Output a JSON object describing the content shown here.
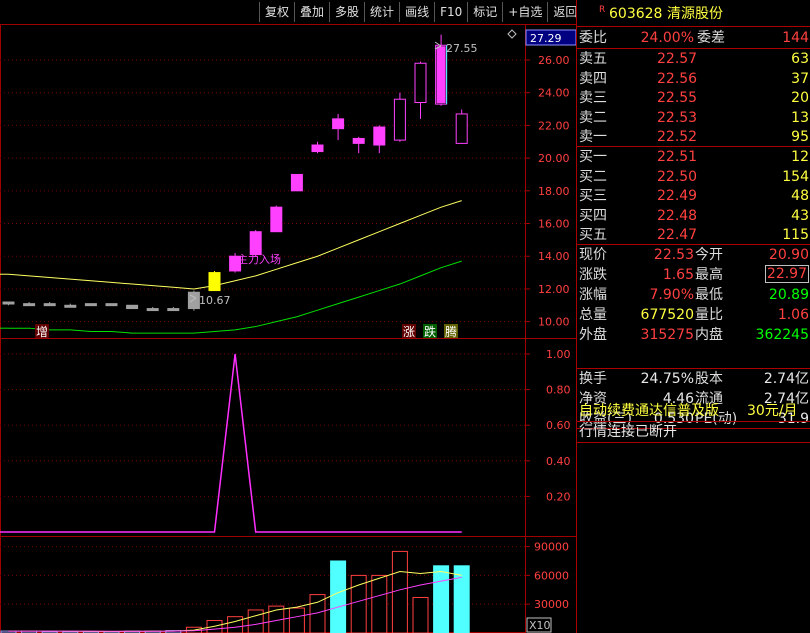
{
  "toolbar": {
    "buttons": [
      "复权",
      "叠加",
      "多股",
      "统计",
      "画线",
      "F10",
      "标记",
      "+自选",
      "返回"
    ]
  },
  "stock": {
    "flag": "R",
    "code": "603628",
    "name": "清源股份"
  },
  "ratio": {
    "label1": "委比",
    "val1": "24.00%",
    "label2": "委差",
    "val2": "144"
  },
  "sell": [
    {
      "label": "卖五",
      "price": "22.57",
      "vol": "63"
    },
    {
      "label": "卖四",
      "price": "22.56",
      "vol": "37"
    },
    {
      "label": "卖三",
      "price": "22.55",
      "vol": "20"
    },
    {
      "label": "卖二",
      "price": "22.53",
      "vol": "13"
    },
    {
      "label": "卖一",
      "price": "22.52",
      "vol": "95"
    }
  ],
  "buy": [
    {
      "label": "买一",
      "price": "22.51",
      "vol": "12"
    },
    {
      "label": "买二",
      "price": "22.50",
      "vol": "154"
    },
    {
      "label": "买三",
      "price": "22.49",
      "vol": "48"
    },
    {
      "label": "买四",
      "price": "22.48",
      "vol": "43"
    },
    {
      "label": "买五",
      "price": "22.47",
      "vol": "115"
    }
  ],
  "quote": [
    {
      "l1": "现价",
      "v1": "22.53",
      "l2": "今开",
      "v2": "20.90"
    },
    {
      "l1": "涨跌",
      "v1": "1.65",
      "l2": "最高",
      "v2": "22.97"
    },
    {
      "l1": "涨幅",
      "v1": "7.90%",
      "l2": "最低",
      "v2": "20.89"
    },
    {
      "l1": "总量",
      "v1": "677520",
      "l2": "量比",
      "v2": "1.06"
    },
    {
      "l1": "外盘",
      "v1": "315275",
      "l2": "内盘",
      "v2": "362245"
    }
  ],
  "fundamentals": [
    {
      "l1": "换手",
      "v1": "24.75%",
      "l2": "股本",
      "v2": "2.74亿"
    },
    {
      "l1": "净资",
      "v1": "4.46",
      "l2": "流通",
      "v2": "2.74亿"
    },
    {
      "l1": "收益(三)",
      "v1": "0.530",
      "l2": "PE(动)",
      "v2": "31.9"
    }
  ],
  "ad": {
    "text": "自动续费通达信普及版",
    "price": "30元/月"
  },
  "status": "行情连接已断开",
  "chart_data": {
    "type": "candlestick",
    "price_axis": {
      "ticks": [
        "26.00",
        "24.00",
        "22.00",
        "20.00",
        "18.00",
        "16.00",
        "14.00",
        "12.00",
        "10.00"
      ],
      "current": "27.29",
      "ylim": [
        9.0,
        28.2
      ]
    },
    "annotations": {
      "high": "27.55",
      "low": "10.67",
      "signal": "主力入场",
      "markers": [
        "增",
        "涨",
        "跌",
        "腾"
      ]
    },
    "candles": [
      {
        "o": 11.2,
        "c": 11.1,
        "h": 11.2,
        "l": 11.0
      },
      {
        "o": 11.1,
        "c": 11.1,
        "h": 11.2,
        "l": 11.0
      },
      {
        "o": 11.1,
        "c": 11.0,
        "h": 11.2,
        "l": 11.0
      },
      {
        "o": 11.0,
        "c": 11.0,
        "h": 11.1,
        "l": 11.0
      },
      {
        "o": 11.0,
        "c": 11.1,
        "h": 11.1,
        "l": 11.0
      },
      {
        "o": 11.0,
        "c": 11.1,
        "h": 11.1,
        "l": 11.0
      },
      {
        "o": 11.0,
        "c": 10.8,
        "h": 11.0,
        "l": 10.8
      },
      {
        "o": 10.8,
        "c": 10.8,
        "h": 10.9,
        "l": 10.7
      },
      {
        "o": 10.8,
        "c": 10.8,
        "h": 10.9,
        "l": 10.7
      },
      {
        "o": 11.8,
        "c": 10.8,
        "h": 11.9,
        "l": 10.67
      },
      {
        "o": 11.9,
        "c": 13.0,
        "h": 13.1,
        "l": 11.9
      },
      {
        "o": 13.1,
        "c": 14.0,
        "h": 14.2,
        "l": 13.0
      },
      {
        "o": 14.1,
        "c": 15.5,
        "h": 15.6,
        "l": 14.0
      },
      {
        "o": 15.5,
        "c": 17.0,
        "h": 17.1,
        "l": 15.5
      },
      {
        "o": 18.0,
        "c": 19.0,
        "h": 19.0,
        "l": 18.0
      },
      {
        "o": 20.4,
        "c": 20.8,
        "h": 21.0,
        "l": 20.3
      },
      {
        "o": 21.8,
        "c": 22.4,
        "h": 22.7,
        "l": 21.1
      },
      {
        "o": 21.2,
        "c": 20.9,
        "h": 21.3,
        "l": 20.3
      },
      {
        "o": 20.8,
        "c": 21.9,
        "h": 22.0,
        "l": 20.3
      },
      {
        "o": 21.1,
        "c": 23.6,
        "h": 24.0,
        "l": 21.0
      },
      {
        "o": 23.4,
        "c": 25.8,
        "h": 25.9,
        "l": 22.4
      },
      {
        "o": 23.3,
        "c": 26.9,
        "h": 27.55,
        "l": 23.2
      },
      {
        "o": 22.7,
        "c": 20.9,
        "h": 22.97,
        "l": 20.89
      }
    ],
    "ma_yellow": [
      12.9,
      12.8,
      12.7,
      12.6,
      12.5,
      12.4,
      12.3,
      12.2,
      12.1,
      12.0,
      12.2,
      12.5,
      12.8,
      13.2,
      13.6,
      14.0,
      14.5,
      15.0,
      15.5,
      16.0,
      16.5,
      17.0,
      17.4
    ],
    "ma_green": [
      9.6,
      9.6,
      9.5,
      9.5,
      9.4,
      9.4,
      9.3,
      9.3,
      9.3,
      9.3,
      9.4,
      9.5,
      9.7,
      10.0,
      10.3,
      10.7,
      11.1,
      11.5,
      11.9,
      12.3,
      12.8,
      13.3,
      13.7
    ],
    "indicator": {
      "ticks": [
        "1.00",
        "0.80",
        "0.60",
        "0.40",
        "0.20"
      ],
      "values": [
        0,
        0,
        0,
        0,
        0,
        0,
        0,
        0,
        0,
        0,
        0,
        1,
        0,
        0,
        0,
        0,
        0,
        0,
        0,
        0,
        0,
        0,
        0
      ]
    },
    "volume": {
      "ticks": [
        "90000",
        "60000",
        "30000"
      ],
      "multiplier": "X10",
      "values": [
        2000,
        2000,
        1500,
        1500,
        1500,
        1500,
        2000,
        2000,
        2500,
        6000,
        13000,
        17000,
        24000,
        28000,
        26000,
        40000,
        75000,
        60000,
        60000,
        85000,
        37000,
        70000,
        70000
      ],
      "ma1": [
        2000,
        2000,
        2000,
        1800,
        1700,
        1600,
        1700,
        1800,
        2000,
        3000,
        7000,
        12000,
        18000,
        24000,
        27000,
        32000,
        42000,
        50000,
        57000,
        64000,
        62000,
        64000,
        60000
      ],
      "ma2": [
        2000,
        2000,
        2000,
        1900,
        1900,
        1800,
        1800,
        1800,
        1900,
        2400,
        4000,
        6000,
        9000,
        13000,
        17000,
        21000,
        27000,
        33000,
        39000,
        45000,
        50000,
        54000,
        58000
      ]
    }
  }
}
